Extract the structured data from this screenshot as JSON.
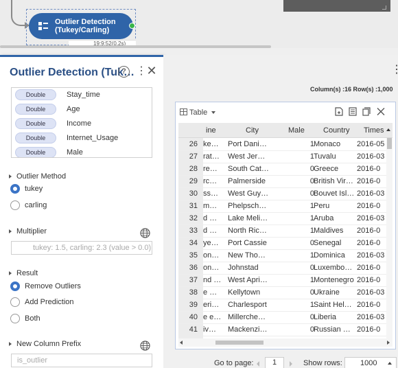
{
  "node": {
    "label_line1": "Outlier Detection",
    "label_line2": "(Tukey/Carling)",
    "meta": "19:9:52(0.2s)"
  },
  "panel": {
    "title": "Outlier Detection (Tuk…",
    "columns": [
      {
        "type": "Double",
        "name": "Stay_time"
      },
      {
        "type": "Double",
        "name": "Age"
      },
      {
        "type": "Double",
        "name": "Income"
      },
      {
        "type": "Double",
        "name": "Internet_Usage"
      },
      {
        "type": "Double",
        "name": "Male"
      }
    ],
    "outlier_method": {
      "label": "Outlier Method",
      "options": [
        "tukey",
        "carling"
      ],
      "selected": "tukey"
    },
    "multiplier": {
      "label": "Multiplier",
      "placeholder": "tukey: 1.5, carling: 2.3 (value > 0.0)"
    },
    "result": {
      "label": "Result",
      "options": [
        "Remove Outliers",
        "Add Prediction",
        "Both"
      ],
      "selected": "Remove Outliers"
    },
    "new_column_prefix": {
      "label": "New Column Prefix",
      "placeholder": "is_outlier"
    }
  },
  "table": {
    "stats": "Column(s) :16   Row(s) :1,000",
    "view": "Table",
    "headers": [
      "ine",
      "City",
      "Male",
      "Country",
      "Times"
    ],
    "rows": [
      [
        "26",
        "ke…",
        "Port Dani…",
        "1",
        "Monaco",
        "2016-05"
      ],
      [
        "27",
        "rat…",
        "West Jer…",
        "1",
        "Tuvalu",
        "2016-03"
      ],
      [
        "28",
        "re…",
        "South Cat…",
        "0",
        "Greece",
        "2016-0"
      ],
      [
        "29",
        "rc…",
        "Palmerside",
        "0",
        "British Vir…",
        "2016-0"
      ],
      [
        "30",
        "ss…",
        "West Guy…",
        "0",
        "Bouvet Isl…",
        "2016-03"
      ],
      [
        "31",
        "m…",
        "Phelpsch…",
        "1",
        "Peru",
        "2016-0"
      ],
      [
        "32",
        "d …",
        "Lake Meli…",
        "1",
        "Aruba",
        "2016-03"
      ],
      [
        "33",
        "d …",
        "North Ric…",
        "1",
        "Maldives",
        "2016-0"
      ],
      [
        "34",
        "ye…",
        "Port Cassie",
        "0",
        "Senegal",
        "2016-0"
      ],
      [
        "35",
        "on…",
        "New Tho…",
        "1",
        "Dominica",
        "2016-03"
      ],
      [
        "36",
        "on…",
        "Johnstad",
        "0",
        "Luxembo…",
        "2016-0"
      ],
      [
        "37",
        "nd …",
        "West Apri…",
        "1",
        "Montenegro",
        "2016-0"
      ],
      [
        "38",
        "e …",
        "Kellytown",
        "0",
        "Ukraine",
        "2016-03"
      ],
      [
        "39",
        "eri…",
        "Charlesport",
        "1",
        "Saint Hel…",
        "2016-0"
      ],
      [
        "40",
        "e e…",
        "Millerche…",
        "0",
        "Liberia",
        "2016-03"
      ],
      [
        "41",
        "iv…",
        "Mackenzi…",
        "0",
        "Russian …",
        "2016-0"
      ]
    ]
  },
  "pager": {
    "go_to_label": "Go to page:",
    "page": "1",
    "show_rows_label": "Show rows:",
    "rows": "1000"
  },
  "colors": {
    "accent": "#2f64a8",
    "radio": "#3b74c6",
    "status_ok": "#39b54a"
  }
}
